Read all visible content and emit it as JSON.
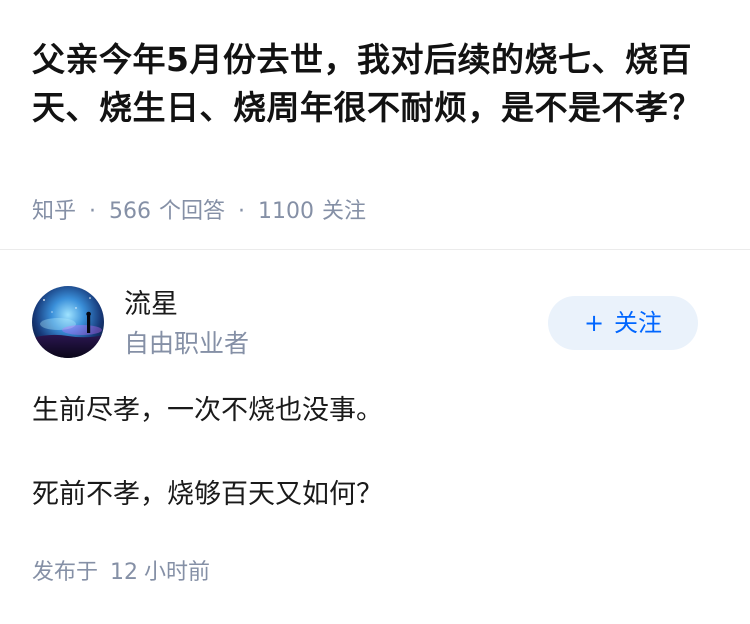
{
  "question": {
    "title": "父亲今年5月份去世，我对后续的烧七、烧百天、烧生日、烧周年很不耐烦，是不是不孝？",
    "source": "知乎",
    "answer_count": "566",
    "answer_unit": "个回答",
    "follower_count": "1100",
    "follower_unit": "关注",
    "separator": "·"
  },
  "answer": {
    "author": {
      "name": "流星",
      "bio": "自由职业者",
      "avatar_icon": "avatar-night-sky-icon"
    },
    "follow_button": {
      "plus": "+",
      "label": "关注"
    },
    "paragraphs": [
      "生前尽孝，一次不烧也没事。",
      "死前不孝，烧够百天又如何？"
    ],
    "published_prefix": "发布于",
    "published_value": "12",
    "published_unit": "小时前"
  },
  "colors": {
    "meta_gray": "#8590a6",
    "brand_blue": "#0066ff",
    "follow_bg": "#eaf2fb",
    "divider": "#ebebeb"
  }
}
